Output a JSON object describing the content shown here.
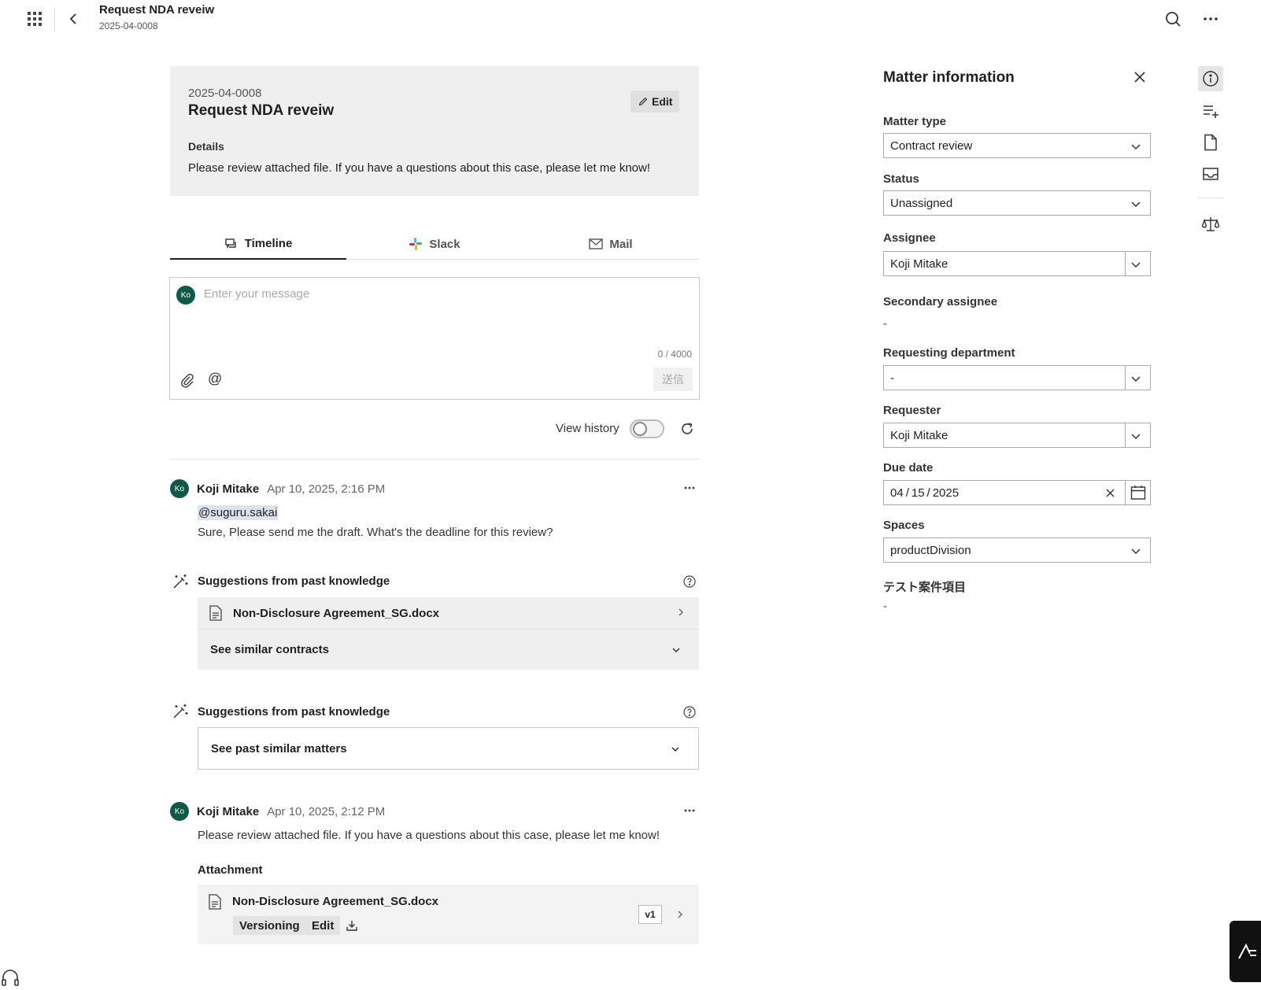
{
  "header": {
    "title": "Request NDA reveiw",
    "subtitle": "2025-04-0008"
  },
  "summary": {
    "number": "2025-04-0008",
    "title": "Request NDA reveiw",
    "edit_label": "Edit",
    "details_label": "Details",
    "details_text": "Please review attached file. If you have a questions about this case, please let me know!"
  },
  "tabs": [
    {
      "label": "Timeline",
      "icon": "chat-icon",
      "active": true
    },
    {
      "label": "Slack",
      "icon": "slack-icon",
      "active": false
    },
    {
      "label": "Mail",
      "icon": "mail-icon",
      "active": false
    }
  ],
  "composer": {
    "avatar": "Ko",
    "placeholder": "Enter your message",
    "counter": "0 / 4000",
    "mention_symbol": "@",
    "send_label": "送信"
  },
  "history": {
    "label": "View history",
    "enabled": false
  },
  "messages": [
    {
      "avatar": "Ko",
      "author": "Koji Mitake",
      "time": "Apr 10, 2025, 2:16 PM",
      "mention": "@suguru.sakai",
      "text": "Sure, Please send me the draft. What's the deadline for this review?"
    },
    {
      "avatar": "Ko",
      "author": "Koji Mitake",
      "time": "Apr 10, 2025, 2:12 PM",
      "text": "Please review attached file. If you have a questions about this case, please let me know!"
    }
  ],
  "suggestions": [
    {
      "title": "Suggestions from past knowledge",
      "file": "Non-Disclosure Agreement_SG.docx",
      "expander": "See similar contracts"
    },
    {
      "title": "Suggestions from past knowledge",
      "expander": "See past similar matters"
    }
  ],
  "attachment": {
    "label": "Attachment",
    "file": "Non-Disclosure Agreement_SG.docx",
    "versioning_label": "Versioning",
    "edit_label": "Edit",
    "version": "v1"
  },
  "panel": {
    "title": "Matter information",
    "fields": {
      "matter_type": {
        "label": "Matter type",
        "value": "Contract review"
      },
      "status": {
        "label": "Status",
        "value": "Unassigned"
      },
      "assignee": {
        "label": "Assignee",
        "value": "Koji Mitake"
      },
      "secondary_assignee": {
        "label": "Secondary assignee",
        "value": "-"
      },
      "requesting_department": {
        "label": "Requesting department",
        "value": "-"
      },
      "requester": {
        "label": "Requester",
        "value": "Koji Mitake"
      },
      "due_date": {
        "label": "Due date",
        "month": "04",
        "day": "15",
        "year": "2025"
      },
      "spaces": {
        "label": "Spaces",
        "value": "productDivision"
      },
      "test_item": {
        "label": "テスト案件項目",
        "value": "-"
      }
    }
  },
  "colors": {
    "avatar": "#0e5a47",
    "card_bg": "#efefef",
    "mention_bg": "#dce3ec"
  }
}
